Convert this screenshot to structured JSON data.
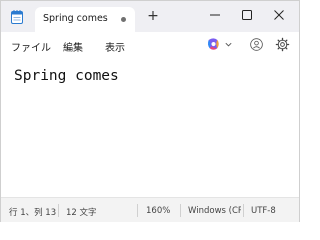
{
  "window": {
    "tab_title": "Spring comes",
    "new_tab_label": "+"
  },
  "menu": {
    "file": "ファイル",
    "edit": "編集",
    "view": "表示"
  },
  "editor": {
    "content": "Spring comes"
  },
  "status": {
    "position": "行 1、列 13",
    "char_count": "12 文字",
    "zoom": "160%",
    "line_ending": "Windows (CRLF)",
    "encoding": "UTF-8"
  },
  "icons": {
    "app": "notepad-icon",
    "unsaved": "unsaved-dot-icon",
    "copilot": "copilot-icon",
    "account": "account-icon",
    "settings": "gear-icon"
  },
  "colors": {
    "titlebar": "#efeff3",
    "tab": "#ffffff",
    "statusbar": "#f3f3f3",
    "app_icon_blue": "#2b7bd0"
  }
}
